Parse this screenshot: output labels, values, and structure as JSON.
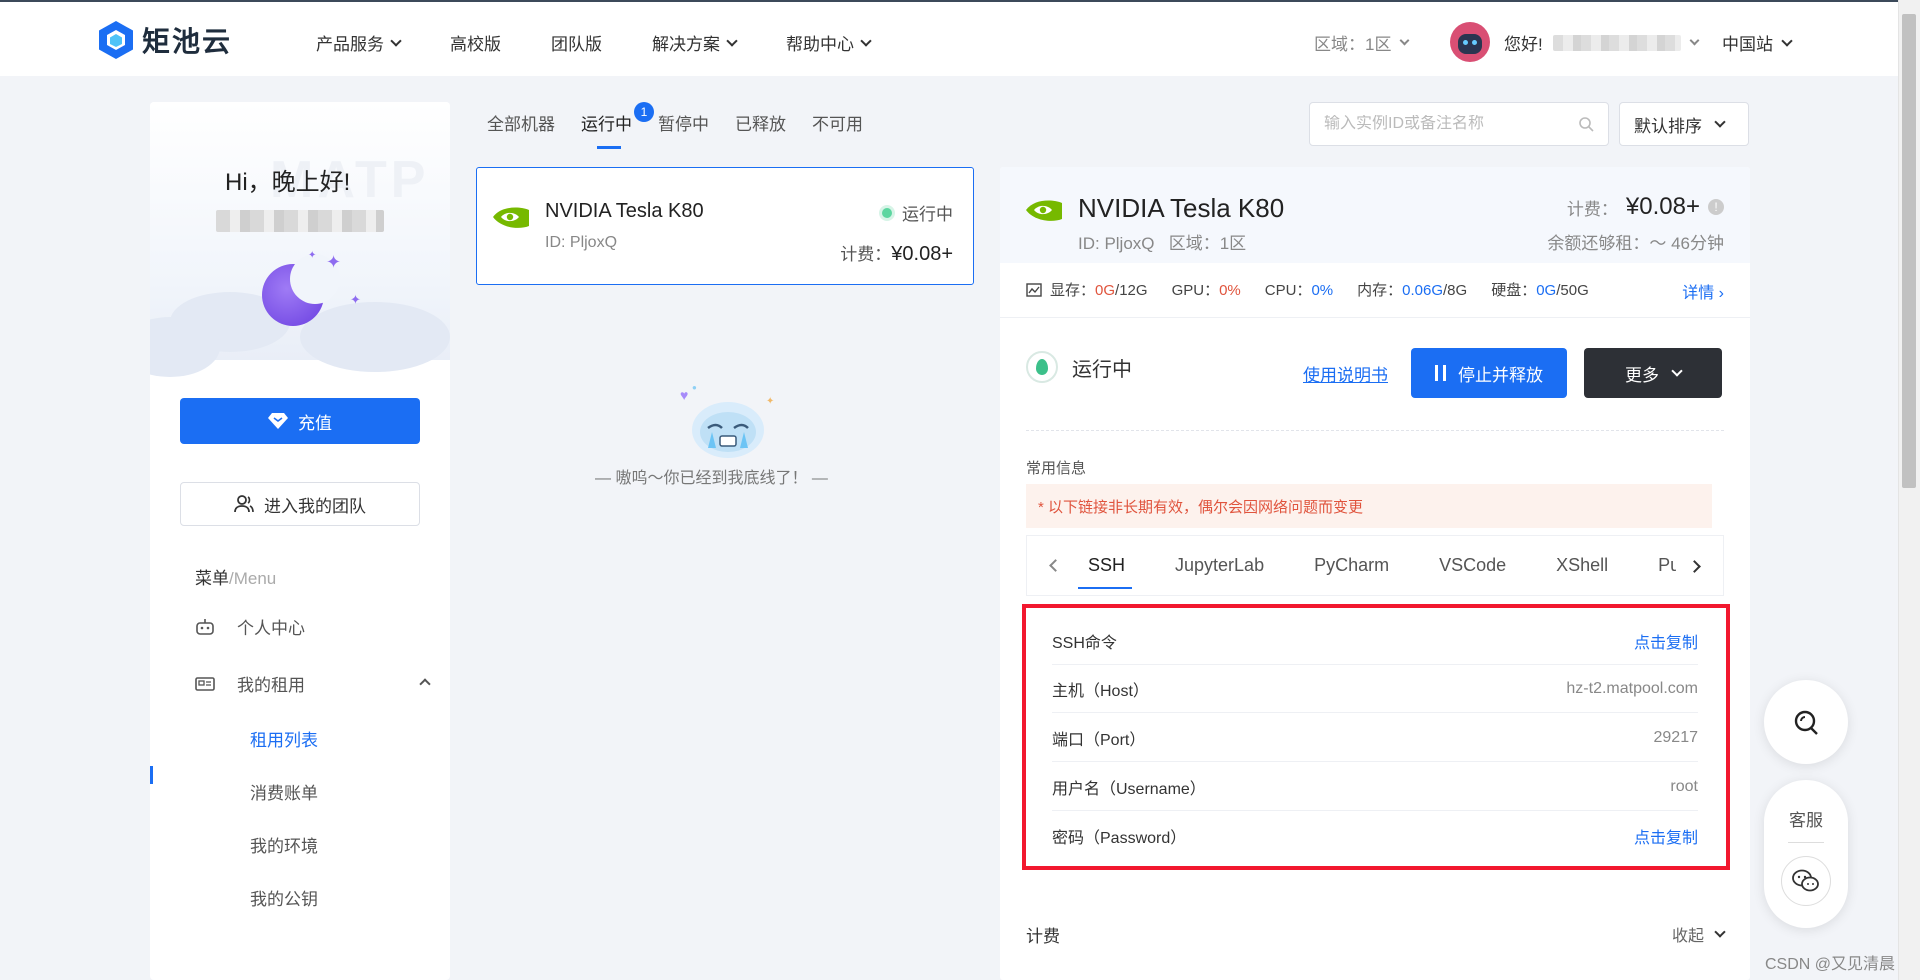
{
  "header": {
    "logo_text": "矩池云",
    "nav": [
      {
        "label": "产品服务",
        "dropdown": true
      },
      {
        "label": "高校版",
        "dropdown": false
      },
      {
        "label": "团队版",
        "dropdown": false
      },
      {
        "label": "解决方案",
        "dropdown": true
      },
      {
        "label": "帮助中心",
        "dropdown": true
      }
    ],
    "region_label": "区域：1区",
    "greeting": "您好!",
    "site_label": "中国站"
  },
  "sidebar": {
    "hello": "Hi，晚上好!",
    "watermark_text": "MATP",
    "recharge_label": "充值",
    "team_label": "进入我的团队",
    "menu_title": "菜单",
    "menu_title_en": "/Menu",
    "items": [
      {
        "label": "个人中心",
        "icon": "robot-icon"
      },
      {
        "label": "我的租用",
        "icon": "rental-card-icon"
      }
    ],
    "sub_items": [
      {
        "label": "租用列表",
        "active": true
      },
      {
        "label": "消费账单",
        "active": false
      },
      {
        "label": "我的环境",
        "active": false
      },
      {
        "label": "我的公钥",
        "active": false
      }
    ]
  },
  "list": {
    "tabs": [
      {
        "label": "全部机器",
        "active": false
      },
      {
        "label": "运行中",
        "active": true,
        "badge": "1"
      },
      {
        "label": "暂停中",
        "active": false
      },
      {
        "label": "已释放",
        "active": false
      },
      {
        "label": "不可用",
        "active": false
      }
    ],
    "search_placeholder": "输入实例ID或备注名称",
    "sort_label": "默认排序",
    "card": {
      "gpu_name": "NVIDIA Tesla K80",
      "id_text": "ID: PljoxQ",
      "status": "运行中",
      "price_prefix": "计费：",
      "price": "¥0.08+"
    },
    "empty_text": "— 嗷呜～你已经到我底线了！ —"
  },
  "detail": {
    "gpu_name": "NVIDIA Tesla K80",
    "id_text": "ID: PljoxQ",
    "region_text": "区域：1区",
    "price_prefix": "计费：",
    "price": "¥0.08+",
    "remain": "余额还够租：～ 46分钟",
    "metrics": {
      "vram_label": "显存：",
      "vram_used": "0G",
      "vram_total": "/12G",
      "gpu_label": "GPU：",
      "gpu_val": "0%",
      "cpu_label": "CPU：",
      "cpu_val": "0%",
      "mem_label": "内存：",
      "mem_used": "0.06G",
      "mem_total": "/8G",
      "disk_label": "硬盘：",
      "disk_used": "0G",
      "disk_total": "/50G",
      "more_label": "详情"
    },
    "status": "运行中",
    "manual_link": "使用说明书",
    "stop_label": "停止并释放",
    "more_label": "更多",
    "common_info_label": "常用信息",
    "notice": "* 以下链接非长期有效，偶尔会因网络问题而变更",
    "conn_tabs": [
      {
        "label": "SSH",
        "active": true
      },
      {
        "label": "JupyterLab",
        "active": false
      },
      {
        "label": "PyCharm",
        "active": false
      },
      {
        "label": "VSCode",
        "active": false
      },
      {
        "label": "XShell",
        "active": false
      },
      {
        "label": "Pu",
        "active": false
      }
    ],
    "ssh": [
      {
        "key": "SSH命令",
        "value": "点击复制",
        "link": true
      },
      {
        "key": "主机（Host）",
        "value": "hz-t2.matpool.com",
        "link": false
      },
      {
        "key": "端口（Port）",
        "value": "29217",
        "link": false
      },
      {
        "key": "用户名（Username）",
        "value": "root",
        "link": false
      },
      {
        "key": "密码（Password）",
        "value": "点击复制",
        "link": true
      }
    ],
    "fee_label": "计费",
    "collapse_label": "收起"
  },
  "floating": {
    "service_label": "客服"
  },
  "watermark": "CSDN @又见清晨",
  "colors": {
    "accent": "#1b6ef3",
    "danger": "#e0543d",
    "highlight_box": "#f2182e",
    "running": "#5cd6a0"
  }
}
